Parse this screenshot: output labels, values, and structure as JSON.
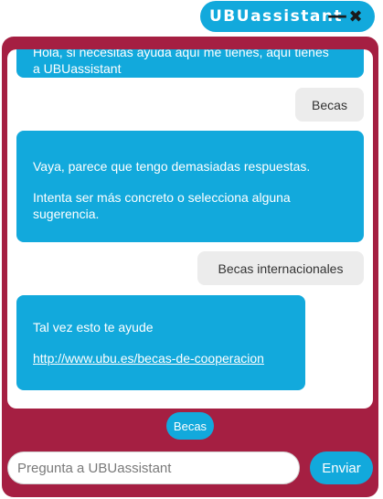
{
  "header": {
    "title": "UBUassistant",
    "minimize_icon": "minus-icon",
    "close_icon": "x-icon",
    "minimize_glyph": "—",
    "close_glyph": "✖"
  },
  "colors": {
    "accent": "#12a9dc",
    "frame": "#a51f42",
    "user_bubble": "#ececec"
  },
  "messages": [
    {
      "from": "bot",
      "lines": [
        "Hola, si necesitas ayuda aquí me tienes, aquí tienes",
        "a UBUassistant"
      ]
    },
    {
      "from": "user",
      "text": "Becas"
    },
    {
      "from": "bot",
      "lines": [
        "Vaya, parece que tengo demasiadas respuestas.",
        "Intenta ser más concreto o selecciona alguna sugerencia."
      ]
    },
    {
      "from": "user",
      "text": "Becas internacionales"
    },
    {
      "from": "bot",
      "lines": [
        "Tal vez esto te ayude"
      ],
      "link": "http://www.ubu.es/becas-de-cooperacion"
    }
  ],
  "suggestions": [
    "Becas"
  ],
  "composer": {
    "placeholder": "Pregunta a UBUassistant",
    "value": "",
    "send_label": "Enviar"
  }
}
